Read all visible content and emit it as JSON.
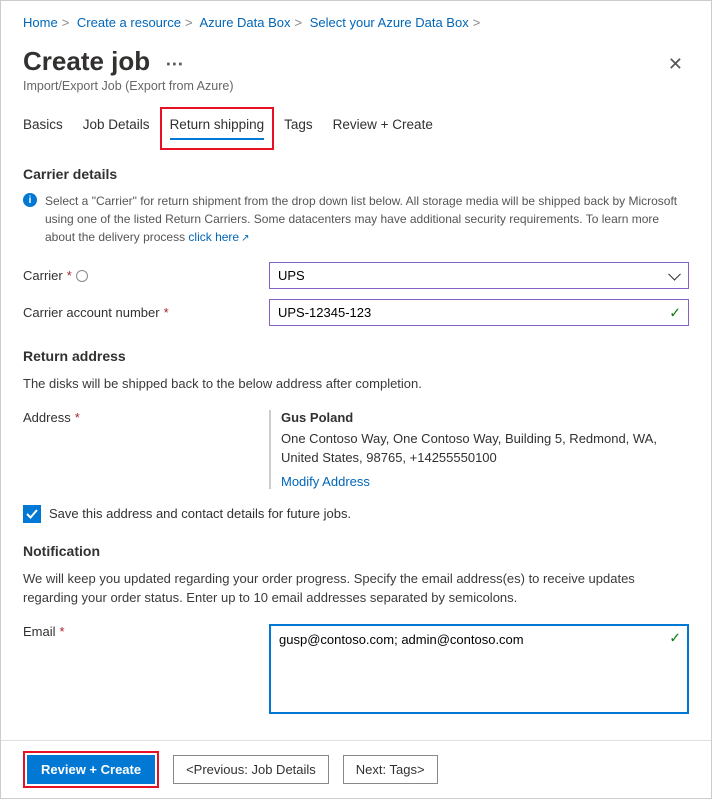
{
  "breadcrumb": {
    "items": [
      "Home",
      "Create a resource",
      "Azure Data Box",
      "Select your Azure Data Box"
    ]
  },
  "header": {
    "title": "Create job",
    "subtitle": "Import/Export Job (Export from Azure)"
  },
  "tabs": {
    "items": [
      "Basics",
      "Job Details",
      "Return shipping",
      "Tags",
      "Review + Create"
    ],
    "active": "Return shipping"
  },
  "carrier_details": {
    "heading": "Carrier details",
    "info": "Select a \"Carrier\" for return shipment from the drop down list below. All storage media will be shipped back by Microsoft using one of the listed Return Carriers. Some datacenters may have additional security requirements. To learn more about the delivery process ",
    "info_link": "click here",
    "carrier_label": "Carrier",
    "carrier_value": "UPS",
    "account_label": "Carrier account number",
    "account_value": "UPS-12345-123"
  },
  "return_address": {
    "heading": "Return address",
    "desc": "The disks will be shipped back to the below address after completion.",
    "address_label": "Address",
    "name": "Gus Poland",
    "line": "One Contoso Way, One Contoso Way, Building 5, Redmond, WA, United States, 98765, +14255550100",
    "modify_link": "Modify Address",
    "save_checkbox_label": "Save this address and contact details for future jobs."
  },
  "notification": {
    "heading": "Notification",
    "desc": "We will keep you updated regarding your order progress. Specify the email address(es) to receive updates regarding your order status. Enter up to 10 email addresses separated by semicolons.",
    "email_label": "Email",
    "email_value": "gusp@contoso.com; admin@contoso.com"
  },
  "footer": {
    "review": "Review + Create",
    "prev": "<Previous: Job Details",
    "next": "Next: Tags>"
  }
}
